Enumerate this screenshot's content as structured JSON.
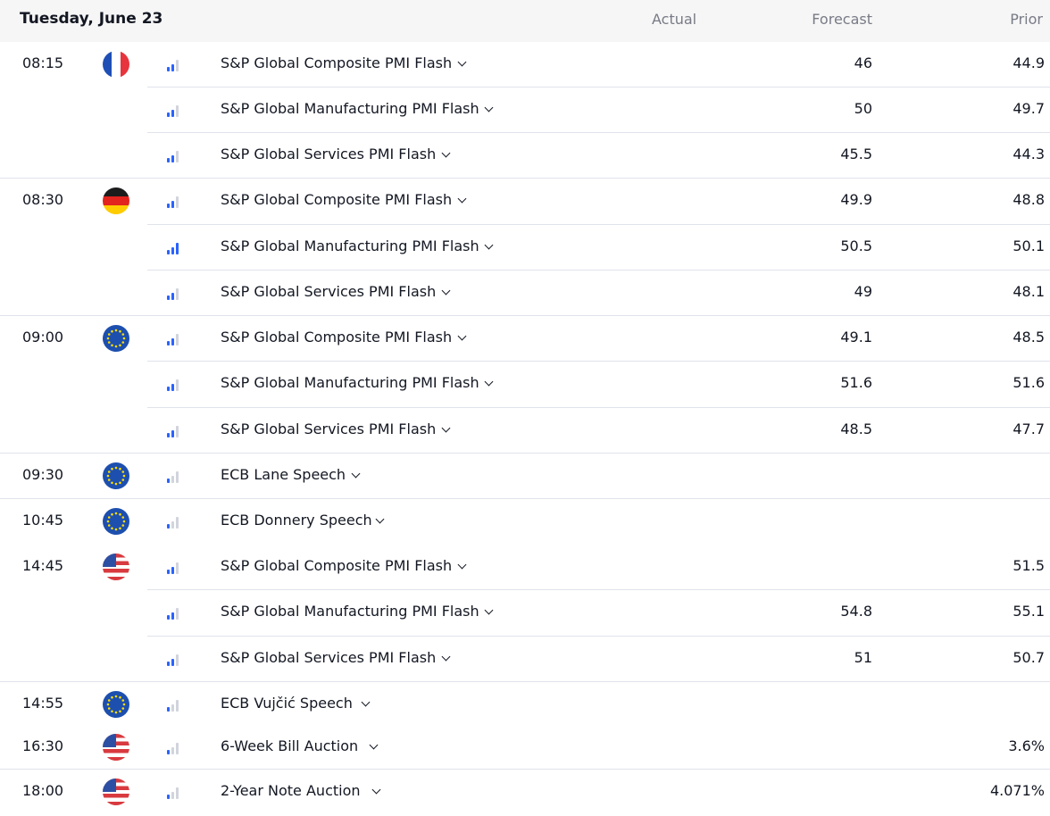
{
  "header": {
    "date": "Tuesday, June 23",
    "actual": "Actual",
    "forecast": "Forecast",
    "prior": "Prior"
  },
  "rows": [
    {
      "time": "08:15",
      "flag": "france-flag-icon",
      "importance": 2,
      "event": "S&P Global Composite PMI Flash",
      "forecast": "46",
      "prior": "44.9"
    },
    {
      "time": "",
      "flag": "",
      "importance": 2,
      "event": "S&P Global Manufacturing PMI Flash",
      "forecast": "50",
      "prior": "49.7"
    },
    {
      "time": "",
      "flag": "",
      "importance": 2,
      "event": "S&P Global Services PMI Flash",
      "forecast": "45.5",
      "prior": "44.3"
    },
    {
      "time": "08:30",
      "flag": "germany-flag-icon",
      "importance": 2,
      "event": "S&P Global Composite PMI Flash",
      "forecast": "49.9",
      "prior": "48.8"
    },
    {
      "time": "",
      "flag": "",
      "importance": 3,
      "event": "S&P Global Manufacturing PMI Flash",
      "forecast": "50.5",
      "prior": "50.1"
    },
    {
      "time": "",
      "flag": "",
      "importance": 2,
      "event": "S&P Global Services PMI Flash",
      "forecast": "49",
      "prior": "48.1"
    },
    {
      "time": "09:00",
      "flag": "eu-flag-icon",
      "importance": 2,
      "event": "S&P Global Composite PMI Flash",
      "forecast": "49.1",
      "prior": "48.5"
    },
    {
      "time": "",
      "flag": "",
      "importance": 2,
      "event": "S&P Global Manufacturing PMI Flash",
      "forecast": "51.6",
      "prior": "51.6"
    },
    {
      "time": "",
      "flag": "",
      "importance": 2,
      "event": "S&P Global Services PMI Flash",
      "forecast": "48.5",
      "prior": "47.7"
    },
    {
      "time": "09:30",
      "flag": "eu-flag-icon",
      "importance": 1,
      "event": "ECB Lane Speech",
      "forecast": "",
      "prior": ""
    },
    {
      "time": "10:45",
      "flag": "eu-flag-icon",
      "importance": 1,
      "event": "ECB Donnery Speech",
      "forecast": "",
      "prior": ""
    },
    {
      "time": "14:45",
      "flag": "us-flag-icon",
      "importance": 2,
      "event": "S&P Global Composite PMI Flash",
      "forecast": "",
      "prior": "51.5"
    },
    {
      "time": "",
      "flag": "",
      "importance": 2,
      "event": "S&P Global Manufacturing PMI Flash",
      "forecast": "54.8",
      "prior": "55.1"
    },
    {
      "time": "",
      "flag": "",
      "importance": 2,
      "event": "S&P Global Services PMI Flash",
      "forecast": "51",
      "prior": "50.7"
    },
    {
      "time": "14:55",
      "flag": "eu-flag-icon",
      "importance": 1,
      "event": "ECB Vujčić Speech",
      "forecast": "",
      "prior": ""
    },
    {
      "time": "16:30",
      "flag": "us-flag-icon",
      "importance": 1,
      "event": "6-Week Bill Auction",
      "forecast": "",
      "prior": "3.6%"
    },
    {
      "time": "18:00",
      "flag": "us-flag-icon",
      "importance": 1,
      "event": "2-Year Note Auction",
      "forecast": "",
      "prior": "4.071%"
    }
  ],
  "colors": {
    "importance_on": "#2962ff",
    "importance_off": "#d1d4dc",
    "divider": "#e0e3eb",
    "header_bg": "#f6f6f6"
  }
}
